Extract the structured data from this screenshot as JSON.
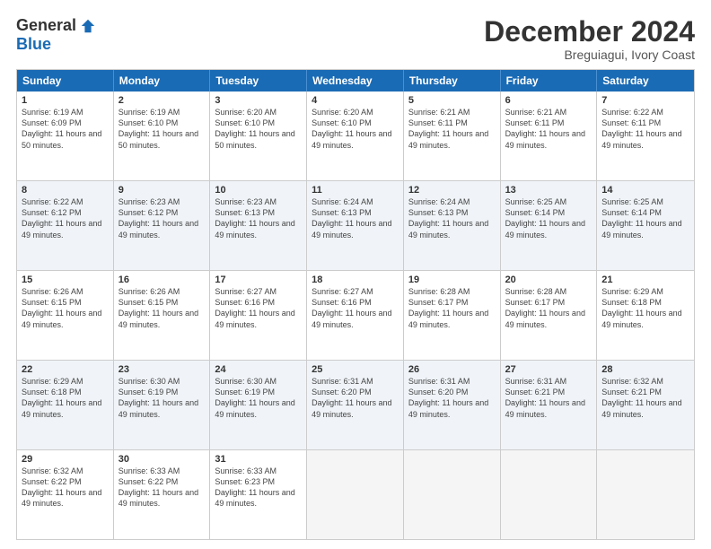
{
  "logo": {
    "general": "General",
    "blue": "Blue"
  },
  "header": {
    "month": "December 2024",
    "location": "Breguiagui, Ivory Coast"
  },
  "days": [
    "Sunday",
    "Monday",
    "Tuesday",
    "Wednesday",
    "Thursday",
    "Friday",
    "Saturday"
  ],
  "weeks": [
    [
      {
        "day": "1",
        "rise": "6:19 AM",
        "set": "6:09 PM",
        "daylight": "11 hours and 50 minutes."
      },
      {
        "day": "2",
        "rise": "6:19 AM",
        "set": "6:10 PM",
        "daylight": "11 hours and 50 minutes."
      },
      {
        "day": "3",
        "rise": "6:20 AM",
        "set": "6:10 PM",
        "daylight": "11 hours and 50 minutes."
      },
      {
        "day": "4",
        "rise": "6:20 AM",
        "set": "6:10 PM",
        "daylight": "11 hours and 49 minutes."
      },
      {
        "day": "5",
        "rise": "6:21 AM",
        "set": "6:11 PM",
        "daylight": "11 hours and 49 minutes."
      },
      {
        "day": "6",
        "rise": "6:21 AM",
        "set": "6:11 PM",
        "daylight": "11 hours and 49 minutes."
      },
      {
        "day": "7",
        "rise": "6:22 AM",
        "set": "6:11 PM",
        "daylight": "11 hours and 49 minutes."
      }
    ],
    [
      {
        "day": "8",
        "rise": "6:22 AM",
        "set": "6:12 PM",
        "daylight": "11 hours and 49 minutes."
      },
      {
        "day": "9",
        "rise": "6:23 AM",
        "set": "6:12 PM",
        "daylight": "11 hours and 49 minutes."
      },
      {
        "day": "10",
        "rise": "6:23 AM",
        "set": "6:13 PM",
        "daylight": "11 hours and 49 minutes."
      },
      {
        "day": "11",
        "rise": "6:24 AM",
        "set": "6:13 PM",
        "daylight": "11 hours and 49 minutes."
      },
      {
        "day": "12",
        "rise": "6:24 AM",
        "set": "6:13 PM",
        "daylight": "11 hours and 49 minutes."
      },
      {
        "day": "13",
        "rise": "6:25 AM",
        "set": "6:14 PM",
        "daylight": "11 hours and 49 minutes."
      },
      {
        "day": "14",
        "rise": "6:25 AM",
        "set": "6:14 PM",
        "daylight": "11 hours and 49 minutes."
      }
    ],
    [
      {
        "day": "15",
        "rise": "6:26 AM",
        "set": "6:15 PM",
        "daylight": "11 hours and 49 minutes."
      },
      {
        "day": "16",
        "rise": "6:26 AM",
        "set": "6:15 PM",
        "daylight": "11 hours and 49 minutes."
      },
      {
        "day": "17",
        "rise": "6:27 AM",
        "set": "6:16 PM",
        "daylight": "11 hours and 49 minutes."
      },
      {
        "day": "18",
        "rise": "6:27 AM",
        "set": "6:16 PM",
        "daylight": "11 hours and 49 minutes."
      },
      {
        "day": "19",
        "rise": "6:28 AM",
        "set": "6:17 PM",
        "daylight": "11 hours and 49 minutes."
      },
      {
        "day": "20",
        "rise": "6:28 AM",
        "set": "6:17 PM",
        "daylight": "11 hours and 49 minutes."
      },
      {
        "day": "21",
        "rise": "6:29 AM",
        "set": "6:18 PM",
        "daylight": "11 hours and 49 minutes."
      }
    ],
    [
      {
        "day": "22",
        "rise": "6:29 AM",
        "set": "6:18 PM",
        "daylight": "11 hours and 49 minutes."
      },
      {
        "day": "23",
        "rise": "6:30 AM",
        "set": "6:19 PM",
        "daylight": "11 hours and 49 minutes."
      },
      {
        "day": "24",
        "rise": "6:30 AM",
        "set": "6:19 PM",
        "daylight": "11 hours and 49 minutes."
      },
      {
        "day": "25",
        "rise": "6:31 AM",
        "set": "6:20 PM",
        "daylight": "11 hours and 49 minutes."
      },
      {
        "day": "26",
        "rise": "6:31 AM",
        "set": "6:20 PM",
        "daylight": "11 hours and 49 minutes."
      },
      {
        "day": "27",
        "rise": "6:31 AM",
        "set": "6:21 PM",
        "daylight": "11 hours and 49 minutes."
      },
      {
        "day": "28",
        "rise": "6:32 AM",
        "set": "6:21 PM",
        "daylight": "11 hours and 49 minutes."
      }
    ],
    [
      {
        "day": "29",
        "rise": "6:32 AM",
        "set": "6:22 PM",
        "daylight": "11 hours and 49 minutes."
      },
      {
        "day": "30",
        "rise": "6:33 AM",
        "set": "6:22 PM",
        "daylight": "11 hours and 49 minutes."
      },
      {
        "day": "31",
        "rise": "6:33 AM",
        "set": "6:23 PM",
        "daylight": "11 hours and 49 minutes."
      },
      null,
      null,
      null,
      null
    ]
  ]
}
